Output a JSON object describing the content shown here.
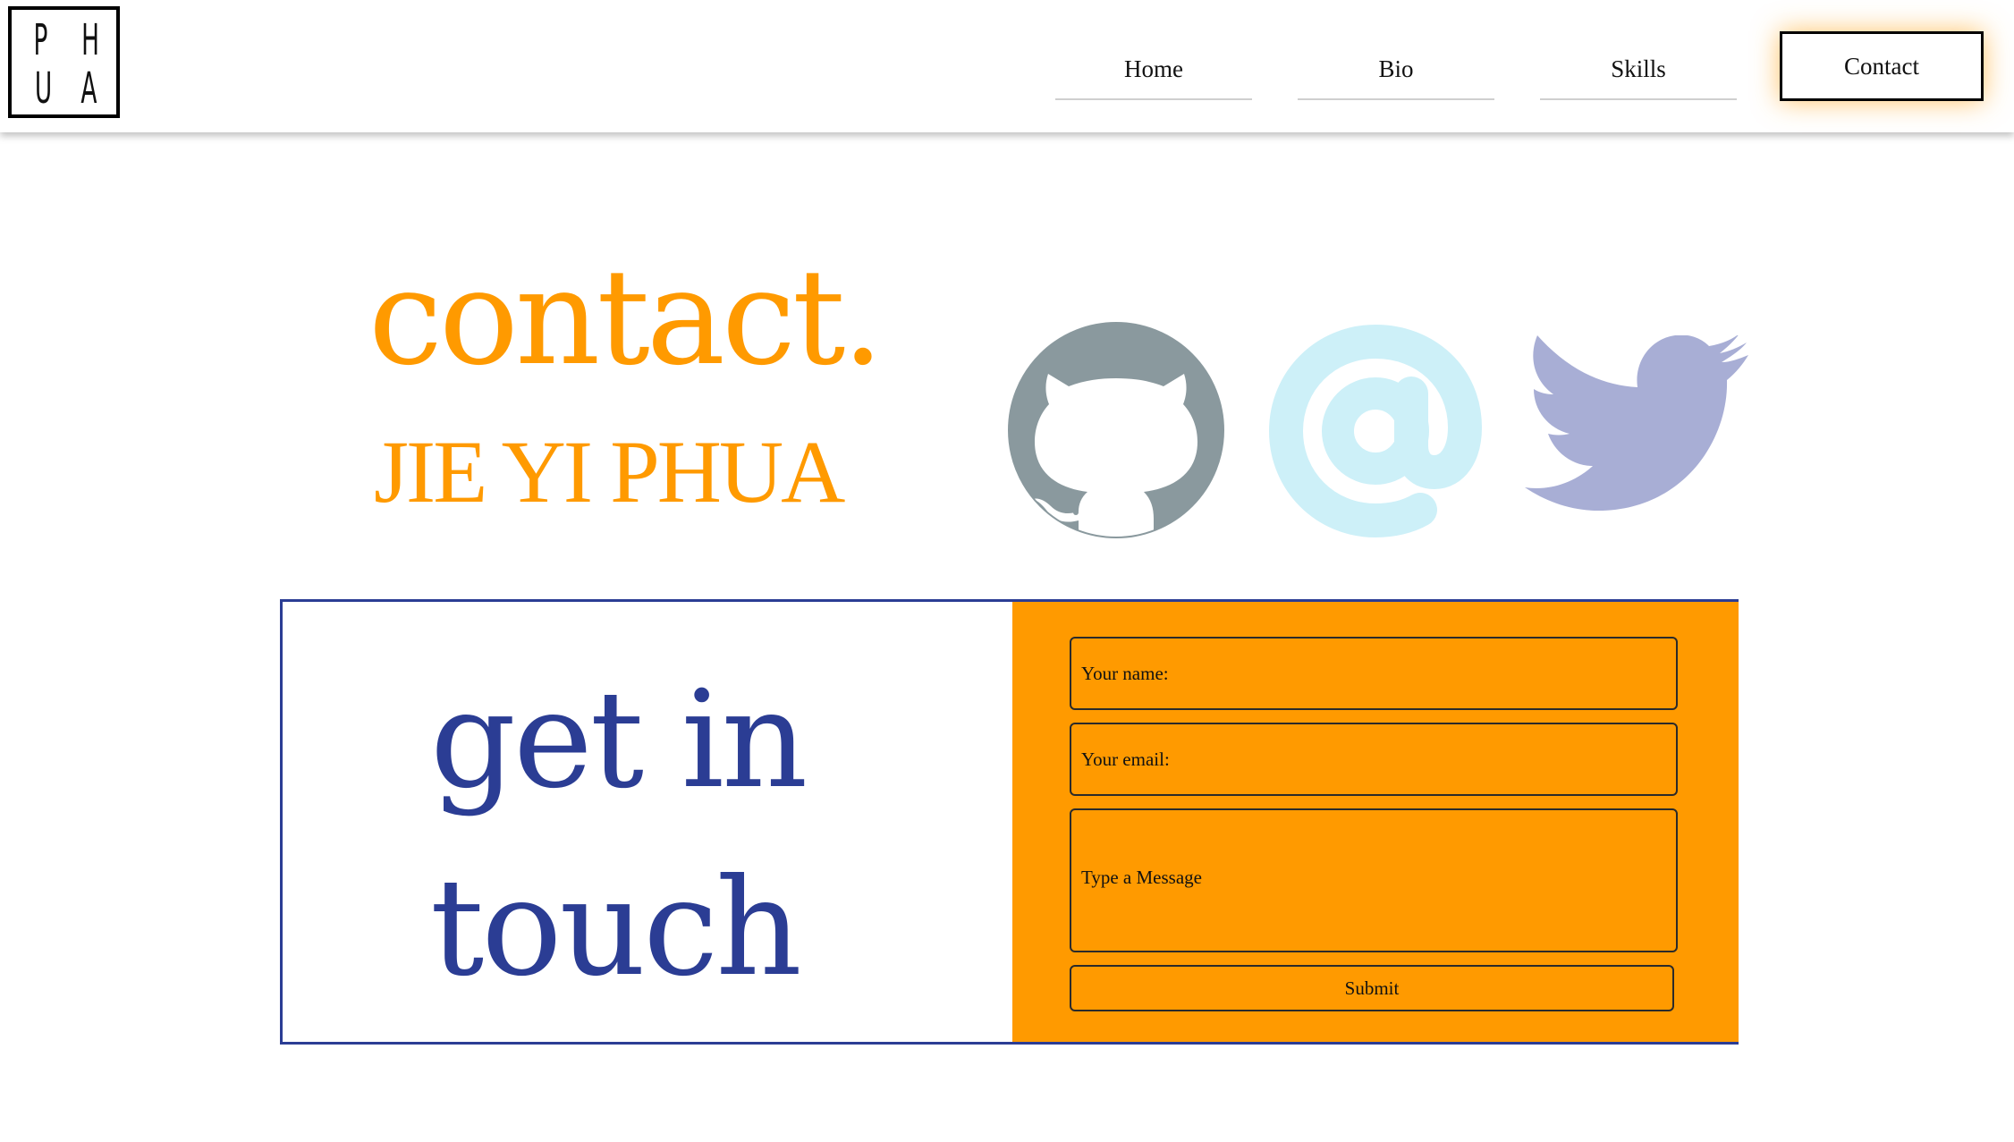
{
  "header": {
    "logo_letters": [
      "P",
      "H",
      "U",
      "A"
    ],
    "nav": [
      {
        "label": "Home",
        "active": false
      },
      {
        "label": "Bio",
        "active": false
      },
      {
        "label": "Skills",
        "active": false
      },
      {
        "label": "Contact",
        "active": true
      }
    ]
  },
  "hero": {
    "title": "contact.",
    "name": "JIE YI PHUA"
  },
  "social": [
    {
      "icon": "github-icon",
      "color": "#8a999e"
    },
    {
      "icon": "at-sign-icon",
      "color": "#cdf0f8"
    },
    {
      "icon": "twitter-icon",
      "color": "#a8aed5"
    }
  ],
  "card": {
    "heading_line1": "get in",
    "heading_line2": "touch",
    "form": {
      "name_placeholder": "Your name:",
      "email_placeholder": "Your email:",
      "message_placeholder": "Type a Message",
      "submit_label": "Submit"
    }
  },
  "colors": {
    "accent_orange": "#ff9a00",
    "navy": "#2b3d94"
  }
}
